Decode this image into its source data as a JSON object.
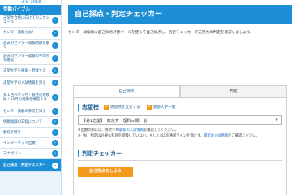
{
  "sidebar": {
    "logo_text": "ナビ 2018",
    "header": "受験パイブル",
    "items": [
      {
        "label": "志望大合格に向けてのスケジュール"
      },
      {
        "label": "センター試験とは？"
      },
      {
        "label": "過去のセンター試験問題を解く"
      },
      {
        "label": "過去のセンター試験の平均点を確認"
      },
      {
        "label": "志望大学を検索・登録する"
      },
      {
        "label": "志望大学の入試情報を見る"
      },
      {
        "label": "第１回ベネッセ・駿台記述模試・10月の成績を確認する"
      },
      {
        "label": "センター試験の事前を知る"
      },
      {
        "label": "併願試験の日程について"
      },
      {
        "label": "験校手続き"
      },
      {
        "label": "インターネット出願"
      },
      {
        "label": "マナガジン"
      },
      {
        "label": "自己採点・判定チェッカー",
        "active": true
      }
    ]
  },
  "main": {
    "title": "自己採点・判定チェッカー",
    "intro": "センター試験後に自己採点計算ツールを使って自己採点し、判定チェッカーで志望大の判定を確認しましょう。",
    "tabs": [
      "自己採点",
      "判定"
    ],
    "shibo_label": "志望校",
    "steps": [
      {
        "num": "1",
        "label": "志望校を変更する"
      },
      {
        "num": "2",
        "label": "志望大学一覧"
      }
    ],
    "select_value": "【第1志望】　東京大　理科三類　前",
    "note1_prefix": "※出願の際には、各大学の",
    "note1_link": "最新の入試情報",
    "note1_suffix": "を確認してください。",
    "note2_prefix": "※「N」判定は必要な科目を受験していない、もしくは1次通過ラインを満たす。",
    "note2_link": "最新の入試情報",
    "note2_suffix": "をご確認ください。",
    "checker_title": "判定チェッカー",
    "start_button": "自己採点をしよう"
  }
}
